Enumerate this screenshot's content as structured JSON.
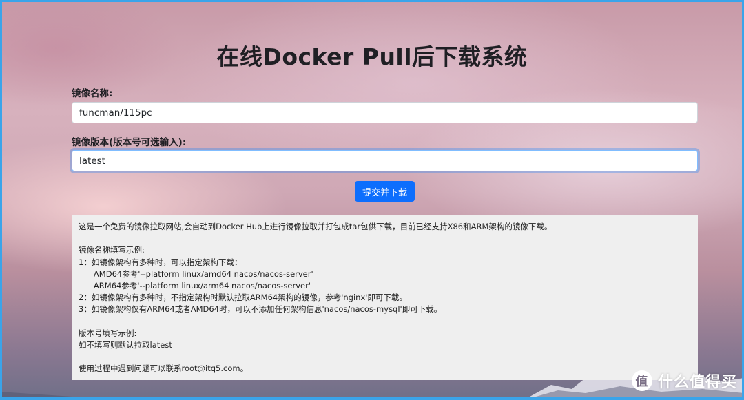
{
  "page": {
    "title": "在线Docker Pull后下载系统"
  },
  "form": {
    "image_name_label": "镜像名称:",
    "image_name_value": "funcman/115pc",
    "image_version_label": "镜像版本(版本号可选输入):",
    "image_version_value": "latest",
    "submit_label": "提交并下载"
  },
  "info": {
    "lines": [
      "这是一个免费的镜像拉取网站,会自动到Docker Hub上进行镜像拉取并打包成tar包供下载，目前已经支持X86和ARM架构的镜像下载。",
      "",
      "镜像名称填写示例:",
      "1：如镜像架构有多种时，可以指定架构下载：",
      "      AMD64参考'--platform linux/amd64 nacos/nacos-server'",
      "      ARM64参考'--platform linux/arm64 nacos/nacos-server'",
      "2：如镜像架构有多种时，不指定架构时默认拉取ARM64架构的镜像，参考'nginx'即可下载。",
      "3：如镜像架构仅有ARM64或者AMD64时，可以不添加任何架构信息'nacos/nacos-mysql'即可下载。",
      "",
      "版本号填写示例:",
      "如不填写则默认拉取latest",
      "",
      "使用过程中遇到问题可以联系root@itq5.com。"
    ]
  },
  "watermark": {
    "badge": "值",
    "text": "什么值得买"
  },
  "colors": {
    "frame": "#3aa4ea",
    "button": "#0d6efd",
    "info_bg": "#efefef"
  }
}
